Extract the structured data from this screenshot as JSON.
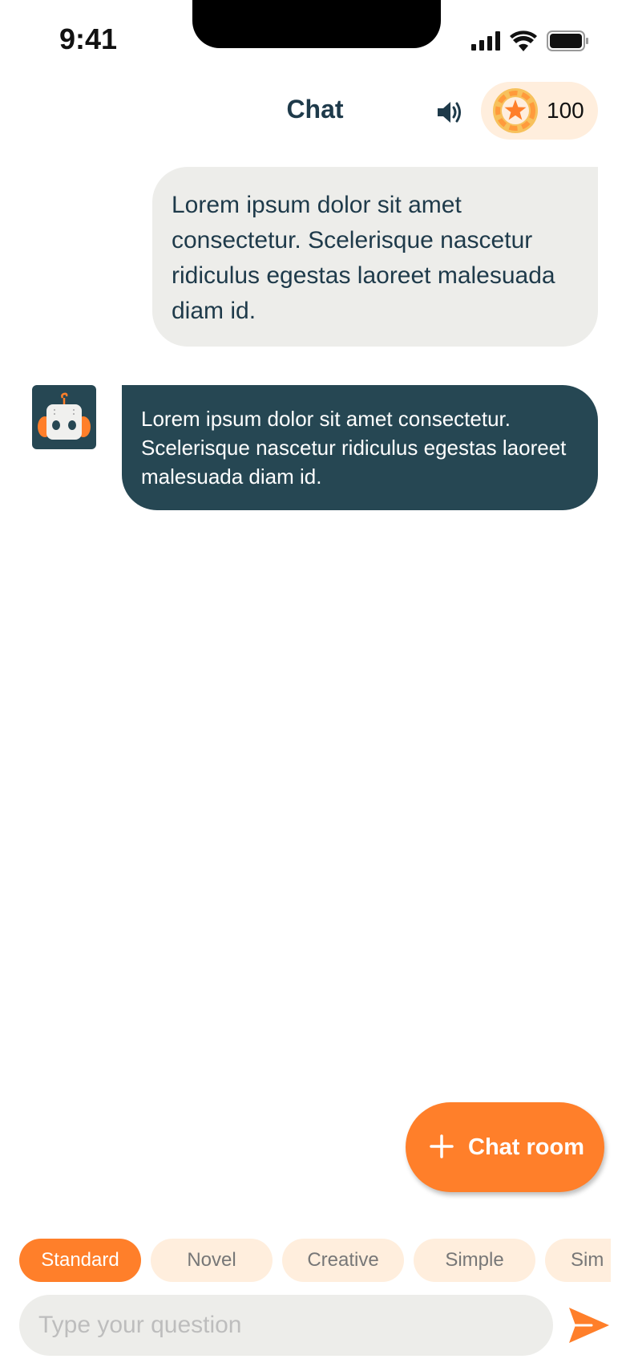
{
  "status_bar": {
    "time": "9:41"
  },
  "header": {
    "title": "Chat",
    "coins": "100"
  },
  "messages": {
    "user": "Lorem ipsum dolor sit amet consectetur. Scelerisque nascetur ridiculus egestas laoreet malesuada diam id.",
    "bot": "Lorem ipsum dolor sit amet consectetur. Scelerisque nascetur ridiculus egestas laoreet malesuada diam id."
  },
  "fab": {
    "label": "Chat room"
  },
  "modes": [
    "Standard",
    "Novel",
    "Creative",
    "Simple",
    "Sim"
  ],
  "composer": {
    "placeholder": "Type your question"
  },
  "colors": {
    "accent": "#ff7f2a",
    "bot_bubble": "#264753",
    "user_bubble": "#ededea",
    "chip_bg": "#ffeedd"
  }
}
